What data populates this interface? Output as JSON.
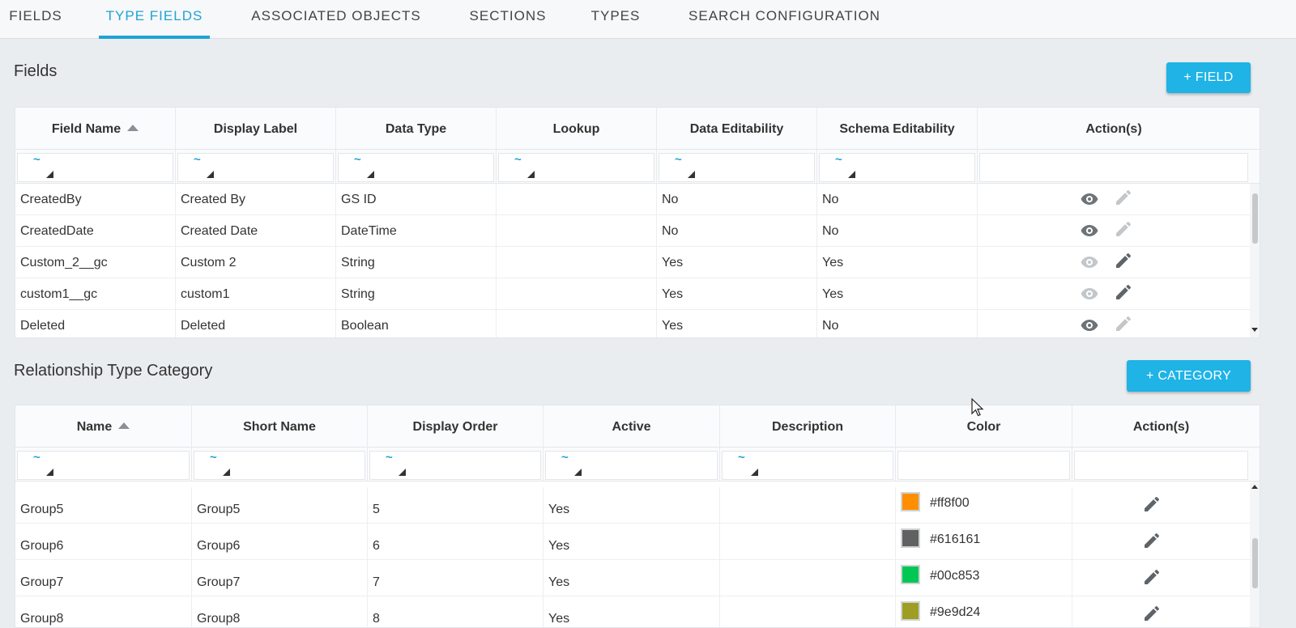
{
  "tabs": [
    {
      "label": "FIELDS"
    },
    {
      "label": "TYPE FIELDS"
    },
    {
      "label": "ASSOCIATED OBJECTS"
    },
    {
      "label": "SECTIONS"
    },
    {
      "label": "TYPES"
    },
    {
      "label": "SEARCH CONFIGURATION"
    }
  ],
  "active_tab": "TYPE FIELDS",
  "fields_section": {
    "title": "Fields",
    "add_button": "+ FIELD",
    "columns": [
      "Field Name",
      "Display Label",
      "Data Type",
      "Lookup",
      "Data Editability",
      "Schema Editability",
      "Action(s)"
    ],
    "filter_symbol": "~",
    "rows": [
      {
        "field_name": "CreatedBy",
        "display_label": "Created By",
        "data_type": "GS ID",
        "lookup": "",
        "data_editability": "No",
        "schema_editability": "No"
      },
      {
        "field_name": "CreatedDate",
        "display_label": "Created Date",
        "data_type": "DateTime",
        "lookup": "",
        "data_editability": "No",
        "schema_editability": "No"
      },
      {
        "field_name": "Custom_2__gc",
        "display_label": "Custom 2",
        "data_type": "String",
        "lookup": "",
        "data_editability": "Yes",
        "schema_editability": "Yes"
      },
      {
        "field_name": "custom1__gc",
        "display_label": "custom1",
        "data_type": "String",
        "lookup": "",
        "data_editability": "Yes",
        "schema_editability": "Yes"
      },
      {
        "field_name": "Deleted",
        "display_label": "Deleted",
        "data_type": "Boolean",
        "lookup": "",
        "data_editability": "Yes",
        "schema_editability": "No"
      }
    ]
  },
  "category_section": {
    "title": "Relationship Type Category",
    "add_button": "+ CATEGORY",
    "columns": [
      "Name",
      "Short Name",
      "Display Order",
      "Active",
      "Description",
      "Color",
      "Action(s)"
    ],
    "filter_symbol": "~",
    "rows": [
      {
        "name": "Group5",
        "short_name": "Group5",
        "display_order": "5",
        "active": "Yes",
        "description": "",
        "color": "#ff8f00"
      },
      {
        "name": "Group6",
        "short_name": "Group6",
        "display_order": "6",
        "active": "Yes",
        "description": "",
        "color": "#616161"
      },
      {
        "name": "Group7",
        "short_name": "Group7",
        "display_order": "7",
        "active": "Yes",
        "description": "",
        "color": "#00c853"
      },
      {
        "name": "Group8",
        "short_name": "Group8",
        "display_order": "8",
        "active": "Yes",
        "description": "",
        "color": "#9e9d24"
      }
    ]
  },
  "icons": {
    "view": "eye-icon",
    "edit": "pencil-icon",
    "sort": "sort-ascending-icon",
    "filter": "tilde-filter-icon"
  },
  "colors": {
    "accent": "#1fa3d7",
    "button": "#1fb3e6",
    "background": "#eaedf0"
  }
}
